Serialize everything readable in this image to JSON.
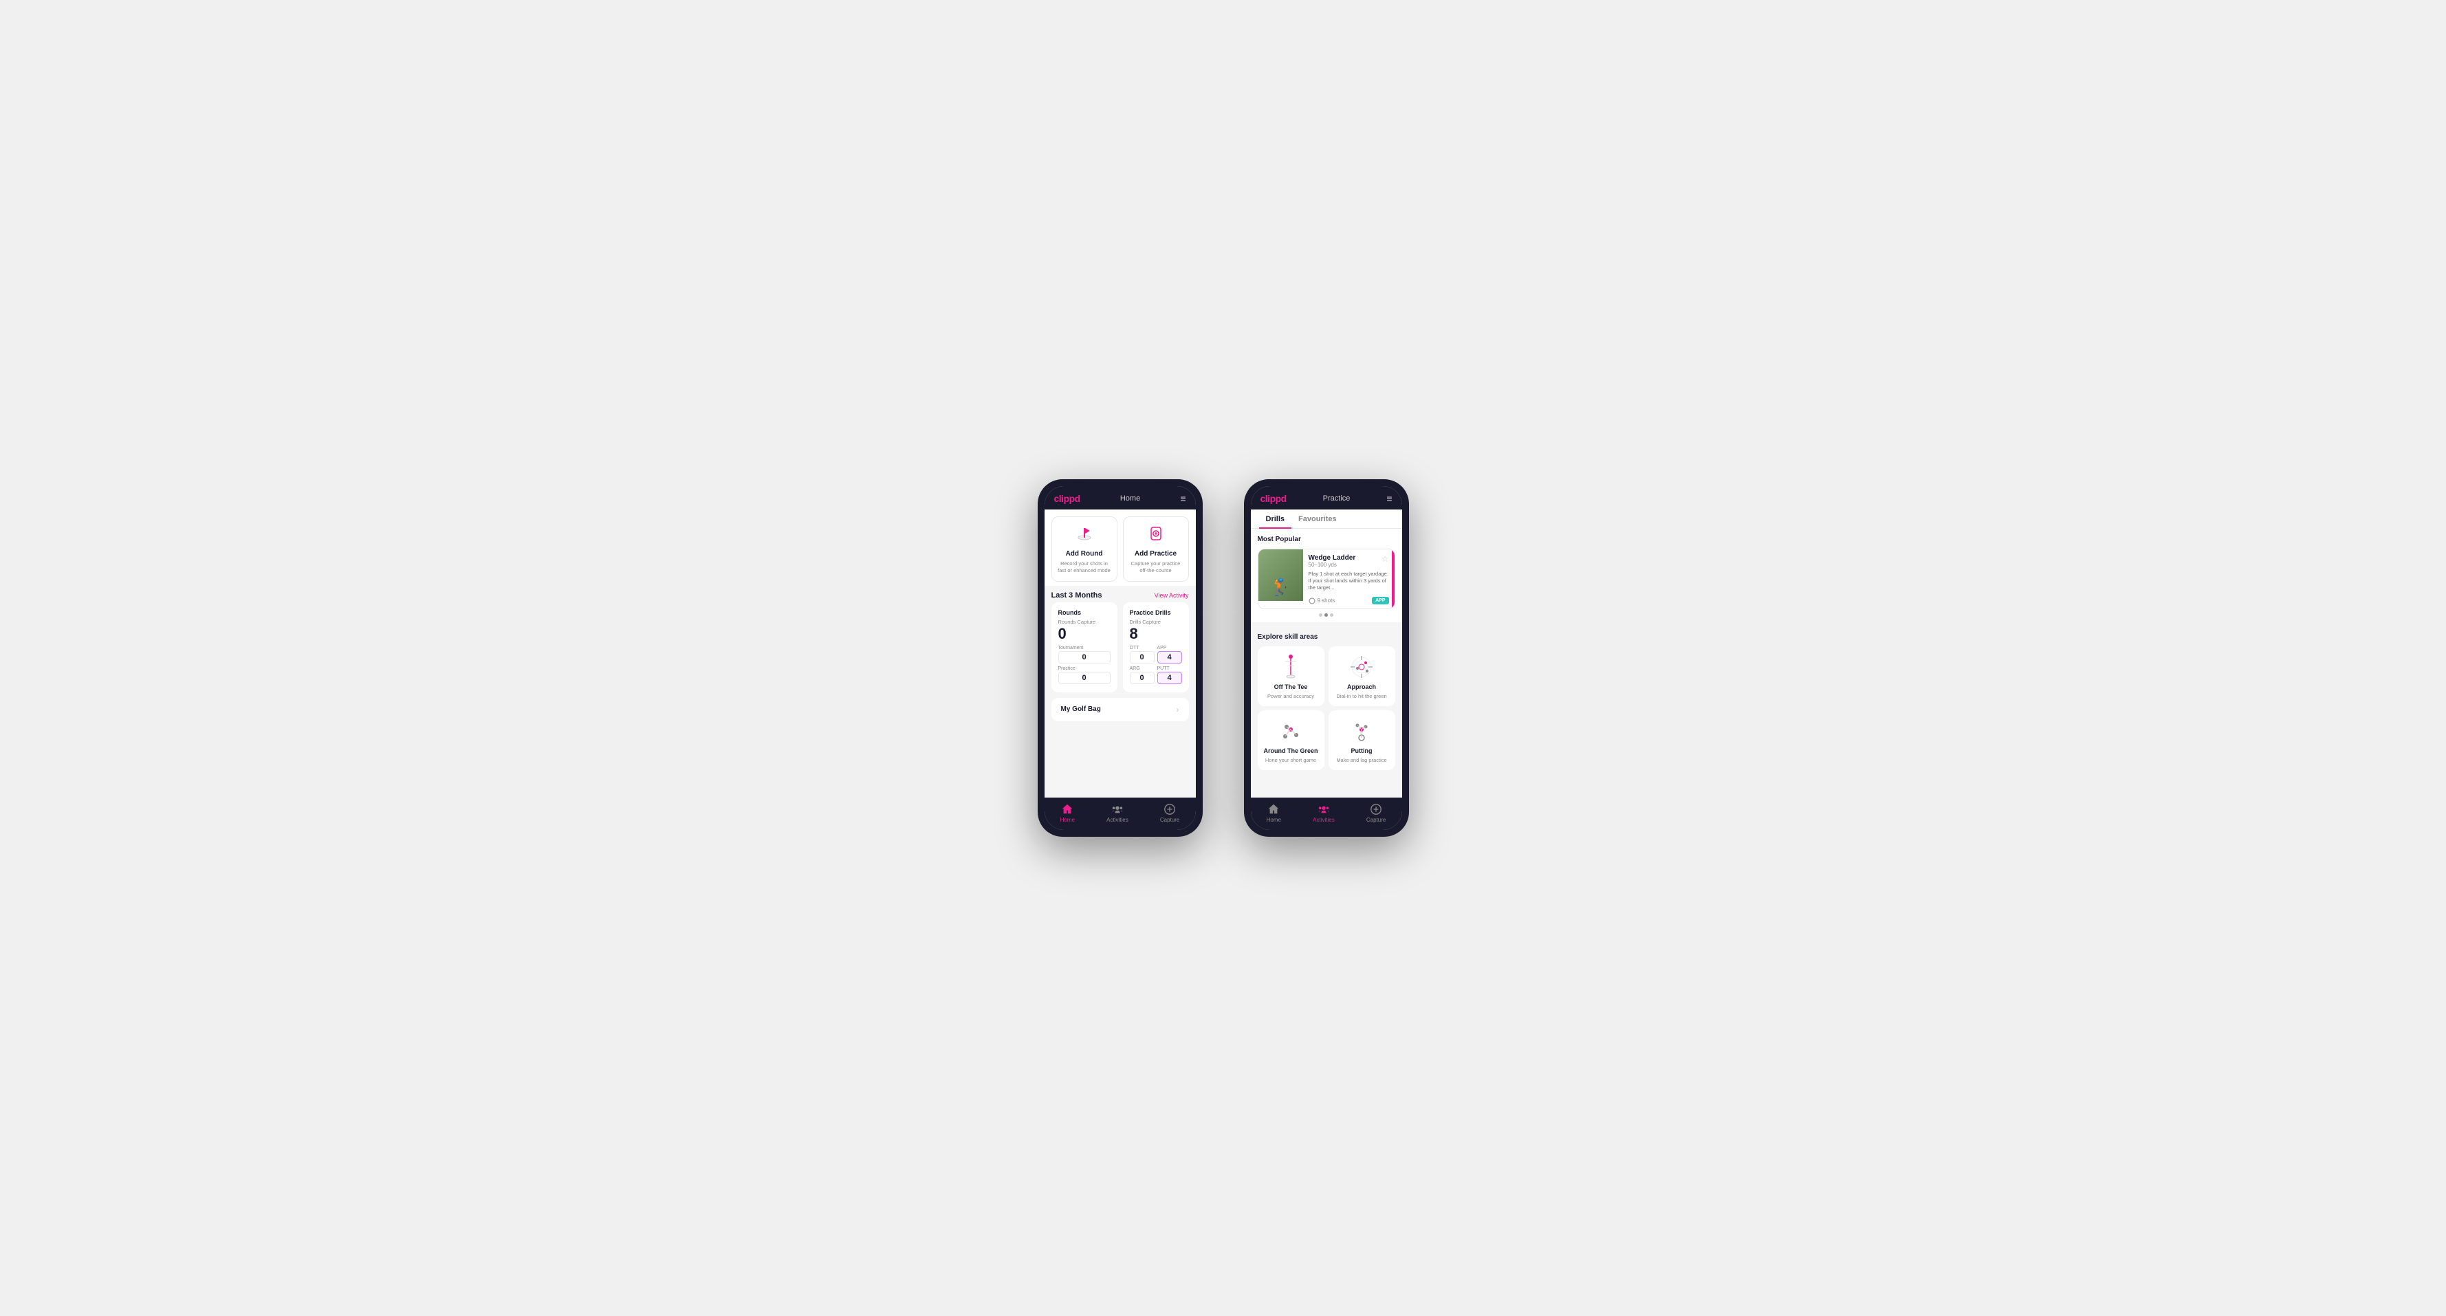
{
  "phone1": {
    "header": {
      "logo": "clippd",
      "title": "Home",
      "menu_icon": "≡"
    },
    "quick_actions": [
      {
        "id": "add-round",
        "title": "Add Round",
        "description": "Record your shots in fast or enhanced mode",
        "icon": "⛳"
      },
      {
        "id": "add-practice",
        "title": "Add Practice",
        "description": "Capture your practice off-the-course",
        "icon": "📋"
      }
    ],
    "last_3_months": {
      "label": "Last 3 Months",
      "link": "View Activity"
    },
    "rounds": {
      "title": "Rounds",
      "capture_label": "Rounds Capture",
      "capture_value": "0",
      "rows": [
        {
          "label": "Tournament",
          "value": "0"
        },
        {
          "label": "Practice",
          "value": "0"
        }
      ]
    },
    "practice_drills": {
      "title": "Practice Drills",
      "capture_label": "Drills Capture",
      "capture_value": "8",
      "cols": [
        {
          "label": "OTT",
          "value": "0"
        },
        {
          "label": "APP",
          "value": "4",
          "highlight": true
        }
      ],
      "cols2": [
        {
          "label": "ARG",
          "value": "0"
        },
        {
          "label": "PUTT",
          "value": "4",
          "highlight": true
        }
      ]
    },
    "golf_bag": {
      "label": "My Golf Bag"
    },
    "nav": [
      {
        "label": "Home",
        "active": true,
        "icon": "home"
      },
      {
        "label": "Activities",
        "active": false,
        "icon": "activities"
      },
      {
        "label": "Capture",
        "active": false,
        "icon": "capture"
      }
    ]
  },
  "phone2": {
    "header": {
      "logo": "clippd",
      "title": "Practice",
      "menu_icon": "≡"
    },
    "tabs": [
      {
        "label": "Drills",
        "active": true
      },
      {
        "label": "Favourites",
        "active": false
      }
    ],
    "most_popular": {
      "title": "Most Popular",
      "drill": {
        "title": "Wedge Ladder",
        "yardage": "50–100 yds",
        "description": "Play 1 shot at each target yardage. If your shot lands within 3 yards of the target...",
        "shots": "9 shots",
        "badge": "APP"
      },
      "dots": [
        false,
        true,
        false
      ]
    },
    "explore_skill_areas": {
      "title": "Explore skill areas",
      "skills": [
        {
          "title": "Off The Tee",
          "description": "Power and accuracy",
          "icon": "tee"
        },
        {
          "title": "Approach",
          "description": "Dial-in to hit the green",
          "icon": "approach"
        },
        {
          "title": "Around The Green",
          "description": "Hone your short game",
          "icon": "around-green"
        },
        {
          "title": "Putting",
          "description": "Make and lag practice",
          "icon": "putting"
        }
      ]
    },
    "nav": [
      {
        "label": "Home",
        "active": false,
        "icon": "home"
      },
      {
        "label": "Activities",
        "active": true,
        "icon": "activities"
      },
      {
        "label": "Capture",
        "active": false,
        "icon": "capture"
      }
    ]
  }
}
